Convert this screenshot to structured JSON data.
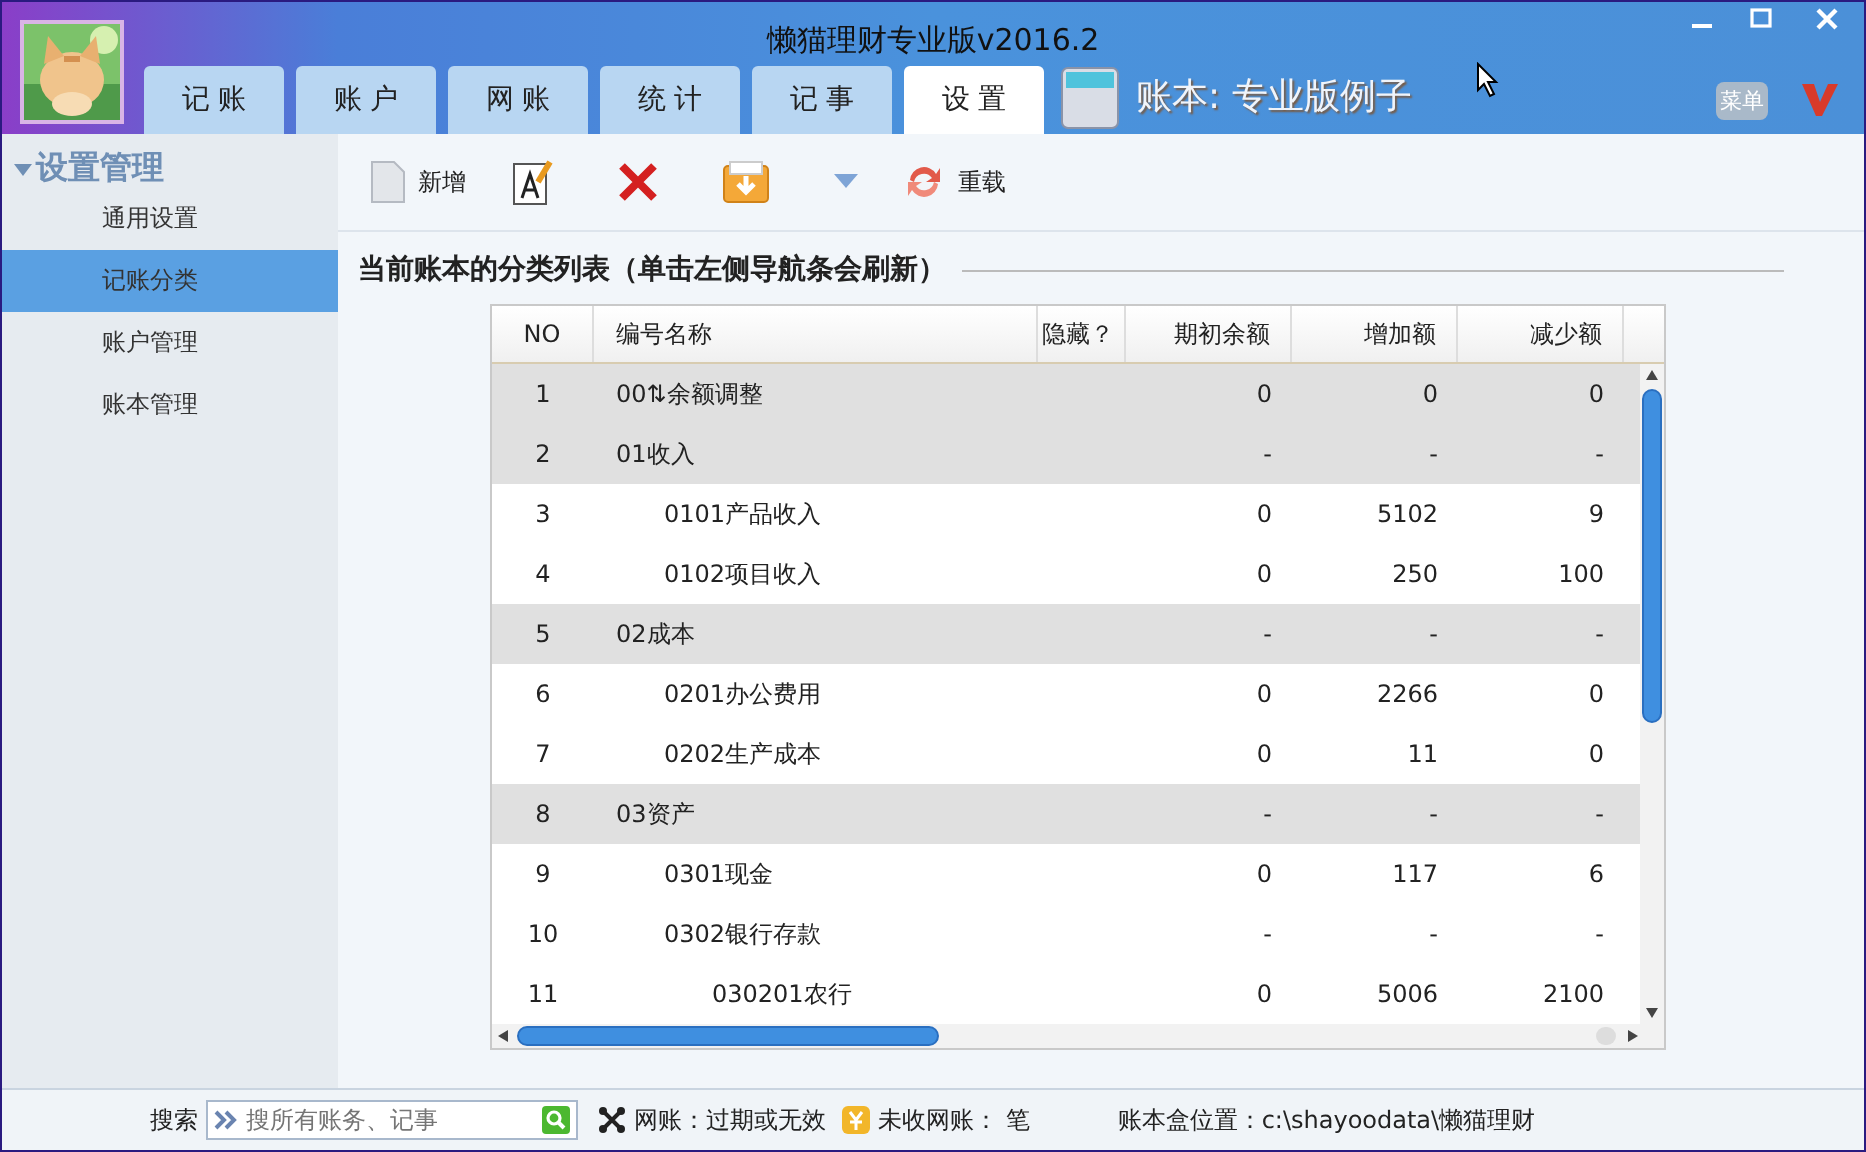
{
  "window": {
    "title": "懒猫理财专业版v2016.2"
  },
  "tabs": [
    {
      "label": "记 账",
      "selected": false
    },
    {
      "label": "账 户",
      "selected": false
    },
    {
      "label": "网 账",
      "selected": false
    },
    {
      "label": "统 计",
      "selected": false
    },
    {
      "label": "记 事",
      "selected": false
    },
    {
      "label": "设 置",
      "selected": true
    }
  ],
  "book_title": "账本: 专业版例子",
  "menu_button": "菜单",
  "sidebar": {
    "heading": "设置管理",
    "items": [
      {
        "label": "通用设置",
        "selected": false
      },
      {
        "label": "记账分类",
        "selected": true
      },
      {
        "label": "账户管理",
        "selected": false
      },
      {
        "label": "账本管理",
        "selected": false
      }
    ]
  },
  "toolbar": [
    {
      "kind": "new",
      "label": "新增"
    },
    {
      "kind": "edit"
    },
    {
      "kind": "delete"
    },
    {
      "kind": "export"
    },
    {
      "kind": "dropdown"
    },
    {
      "kind": "reload",
      "label": "重载"
    }
  ],
  "section_title": "当前账本的分类列表（单击左侧导航条会刷新）",
  "table": {
    "columns": [
      "NO",
      "编号名称",
      "隐藏？",
      "期初余额",
      "增加额",
      "减少额"
    ],
    "rows": [
      {
        "no": "1",
        "name": "00⇅余额调整",
        "initial": "0",
        "increase": "0",
        "decrease": "0"
      },
      {
        "no": "2",
        "name": "01收入",
        "initial": "-",
        "increase": "-",
        "decrease": "-",
        "children": [
          {
            "no": "3",
            "name": "0101产品收入",
            "initial": "0",
            "increase": "5102",
            "decrease": "9"
          },
          {
            "no": "4",
            "name": "0102项目收入",
            "initial": "0",
            "increase": "250",
            "decrease": "100"
          }
        ]
      },
      {
        "no": "5",
        "name": "02成本",
        "initial": "-",
        "increase": "-",
        "decrease": "-",
        "children": [
          {
            "no": "6",
            "name": "0201办公费用",
            "initial": "0",
            "increase": "2266",
            "decrease": "0"
          },
          {
            "no": "7",
            "name": "0202生产成本",
            "initial": "0",
            "increase": "11",
            "decrease": "0"
          }
        ]
      },
      {
        "no": "8",
        "name": "03资产",
        "initial": "-",
        "increase": "-",
        "decrease": "-",
        "children": [
          {
            "no": "9",
            "name": "0301现金",
            "initial": "0",
            "increase": "117",
            "decrease": "6"
          },
          {
            "no": "10",
            "name": "0302银行存款",
            "initial": "-",
            "increase": "-",
            "decrease": "-",
            "children": [
              {
                "no": "11",
                "name": "030201农行",
                "initial": "0",
                "increase": "5006",
                "decrease": "2100"
              }
            ]
          }
        ]
      }
    ]
  },
  "status_bar": {
    "search_label": "搜索",
    "search_placeholder": "搜所有账务、记事",
    "net_status": "网账：过期或无效",
    "uncollected": "未收网账： 笔",
    "location": "账本盒位置：c:\\shayoodata\\懒猫理财"
  }
}
